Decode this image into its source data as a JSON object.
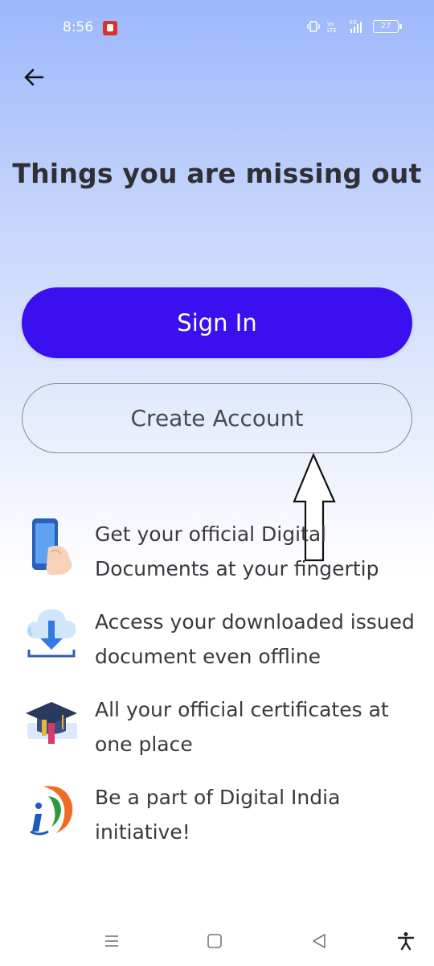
{
  "status_bar": {
    "time": "8:56",
    "network_label": "4G",
    "battery_level": "27"
  },
  "header": {
    "back_icon": "arrow-left-icon"
  },
  "page": {
    "title": "Things you are missing out"
  },
  "buttons": {
    "sign_in": "Sign In",
    "create_account": "Create Account"
  },
  "features": [
    {
      "icon": "phone-hand-icon",
      "text": "Get your official Digital Documents at your fingertip"
    },
    {
      "icon": "cloud-download-icon",
      "text": "Access your downloaded issued document even offline"
    },
    {
      "icon": "graduation-cap-icon",
      "text": "All your official certificates at one place"
    },
    {
      "icon": "digital-india-logo-icon",
      "text": "Be a part of Digital India initiative!"
    }
  ],
  "colors": {
    "primary": "#3a0ff0",
    "gradient_top": "#9cb7fb",
    "text": "#3a3a3e"
  }
}
